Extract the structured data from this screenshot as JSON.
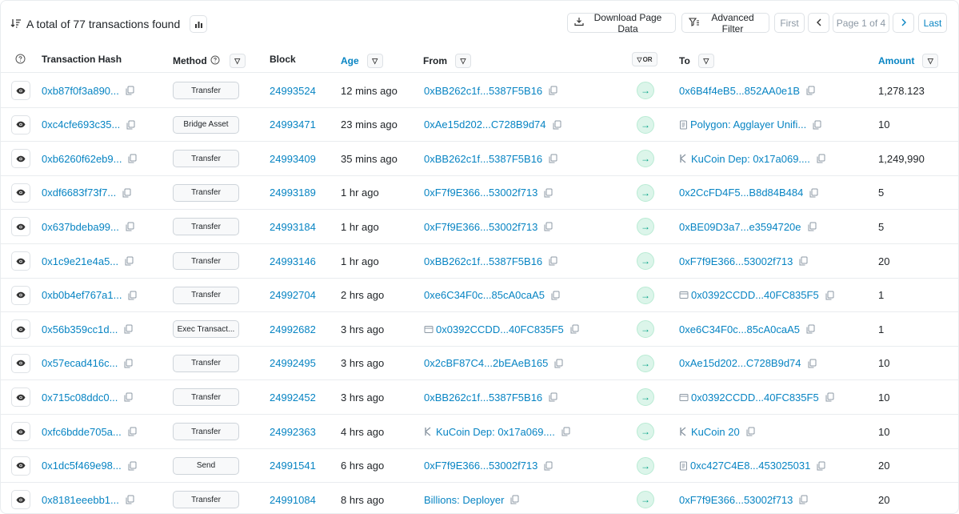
{
  "summary": {
    "text": "A total of 77 transactions found"
  },
  "toolbar": {
    "download_label": "Download Page Data",
    "advanced_filter_label": "Advanced Filter",
    "first_label": "First",
    "page_label": "Page 1 of 4",
    "last_label": "Last"
  },
  "columns": {
    "hash": "Transaction Hash",
    "method": "Method",
    "block": "Block",
    "age": "Age",
    "from": "From",
    "or": "OR",
    "to": "To",
    "amount": "Amount"
  },
  "rows": [
    {
      "hash": "0xb87f0f3a890...",
      "method": "Transfer",
      "block": "24993524",
      "age": "12 mins ago",
      "from": "0xBB262c1f...5387F5B16",
      "from_icon": "",
      "to": "0x6B4f4eB5...852AA0e1B",
      "to_icon": "",
      "amount": "1,278.123"
    },
    {
      "hash": "0xc4cfe693c35...",
      "method": "Bridge Asset",
      "block": "24993471",
      "age": "23 mins ago",
      "from": "0xAe15d202...C728B9d74",
      "from_icon": "",
      "to": "Polygon: Agglayer Unifi...",
      "to_icon": "doc-icon",
      "amount": "10"
    },
    {
      "hash": "0xb6260f62eb9...",
      "method": "Transfer",
      "block": "24993409",
      "age": "35 mins ago",
      "from": "0xBB262c1f...5387F5B16",
      "from_icon": "",
      "to": "KuCoin Dep: 0x17a069....",
      "to_icon": "exchange-icon",
      "amount": "1,249,990"
    },
    {
      "hash": "0xdf6683f73f7...",
      "method": "Transfer",
      "block": "24993189",
      "age": "1 hr ago",
      "from": "0xF7f9E366...53002f713",
      "from_icon": "",
      "to": "0x2CcFD4F5...B8d84B484",
      "to_icon": "",
      "amount": "5"
    },
    {
      "hash": "0x637bdeba99...",
      "method": "Transfer",
      "block": "24993184",
      "age": "1 hr ago",
      "from": "0xF7f9E366...53002f713",
      "from_icon": "",
      "to": "0xBE09D3a7...e3594720e",
      "to_icon": "",
      "amount": "5"
    },
    {
      "hash": "0x1c9e21e4a5...",
      "method": "Transfer",
      "block": "24993146",
      "age": "1 hr ago",
      "from": "0xBB262c1f...5387F5B16",
      "from_icon": "",
      "to": "0xF7f9E366...53002f713",
      "to_icon": "",
      "amount": "20"
    },
    {
      "hash": "0xb0b4ef767a1...",
      "method": "Transfer",
      "block": "24992704",
      "age": "2 hrs ago",
      "from": "0xe6C34F0c...85cA0caA5",
      "from_icon": "",
      "to": "0x0392CCDD...40FC835F5",
      "to_icon": "contract-icon",
      "amount": "1"
    },
    {
      "hash": "0x56b359cc1d...",
      "method": "Exec Transact...",
      "block": "24992682",
      "age": "3 hrs ago",
      "from": "0x0392CCDD...40FC835F5",
      "from_icon": "contract-icon",
      "to": "0xe6C34F0c...85cA0caA5",
      "to_icon": "",
      "amount": "1"
    },
    {
      "hash": "0x57ecad416c...",
      "method": "Transfer",
      "block": "24992495",
      "age": "3 hrs ago",
      "from": "0x2cBF87C4...2bEAeB165",
      "from_icon": "",
      "to": "0xAe15d202...C728B9d74",
      "to_icon": "",
      "amount": "10"
    },
    {
      "hash": "0x715c08ddc0...",
      "method": "Transfer",
      "block": "24992452",
      "age": "3 hrs ago",
      "from": "0xBB262c1f...5387F5B16",
      "from_icon": "",
      "to": "0x0392CCDD...40FC835F5",
      "to_icon": "contract-icon",
      "amount": "10"
    },
    {
      "hash": "0xfc6bdde705a...",
      "method": "Transfer",
      "block": "24992363",
      "age": "4 hrs ago",
      "from": "KuCoin Dep: 0x17a069....",
      "from_icon": "exchange-icon",
      "to": "KuCoin 20",
      "to_icon": "exchange-icon",
      "amount": "10"
    },
    {
      "hash": "0x1dc5f469e98...",
      "method": "Send",
      "block": "24991541",
      "age": "6 hrs ago",
      "from": "0xF7f9E366...53002f713",
      "from_icon": "",
      "to": "0xc427C4E8...453025031",
      "to_icon": "doc-icon",
      "amount": "20"
    },
    {
      "hash": "0x8181eeebb1...",
      "method": "Transfer",
      "block": "24991084",
      "age": "8 hrs ago",
      "from": "Billions: Deployer",
      "from_icon": "",
      "to": "0xF7f9E366...53002f713",
      "to_icon": "",
      "amount": "20"
    }
  ]
}
